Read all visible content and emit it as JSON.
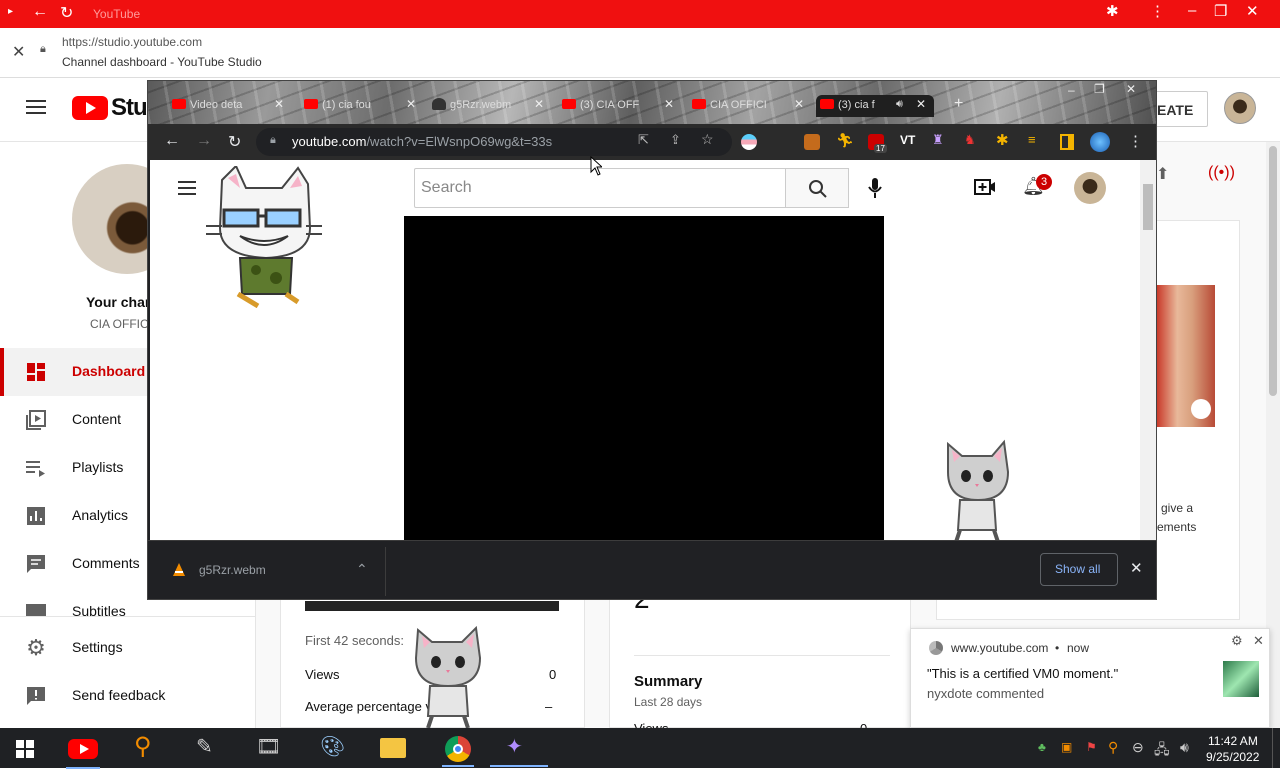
{
  "outer_window": {
    "title": "YouTube"
  },
  "popup": {
    "url": "https://studio.youtube.com",
    "title": "Channel dashboard - YouTube Studio"
  },
  "studio": {
    "logo_text": "Stud",
    "create_label": "EATE",
    "channel_label": "Your char",
    "channel_name": "CIA OFFICI",
    "nav": [
      {
        "label": "Dashboard",
        "icon": "dashboard-icon"
      },
      {
        "label": "Content",
        "icon": "content-icon"
      },
      {
        "label": "Playlists",
        "icon": "playlists-icon"
      },
      {
        "label": "Analytics",
        "icon": "analytics-icon"
      },
      {
        "label": "Comments",
        "icon": "comments-icon"
      },
      {
        "label": "Subtitles",
        "icon": "subtitles-icon"
      }
    ],
    "nav_bottom": [
      {
        "label": "Settings",
        "icon": "gear-icon"
      },
      {
        "label": "Send feedback",
        "icon": "feedback-icon"
      }
    ],
    "card_left": {
      "first_seconds": "First 42 seconds:",
      "views_label": "Views",
      "views_value": "0",
      "avg_label": "Average percentage v",
      "avg_value": "–"
    },
    "card_mid": {
      "big_number": "2",
      "summary": "Summary",
      "period": "Last 28 days",
      "views_label": "Views",
      "views_value": "0"
    },
    "card_right": {
      "text1": "give a",
      "text2": "ements"
    }
  },
  "browser": {
    "tabs": [
      {
        "label": "Video deta"
      },
      {
        "label": "(1) cia fou"
      },
      {
        "label": "g5Rzr.webm"
      },
      {
        "label": "(3) CIA OFF"
      },
      {
        "label": "CIA OFFICI"
      },
      {
        "label": "(3) cia f"
      }
    ],
    "url_host": "youtube.com",
    "url_path": "/watch?v=ElWsnpO69wg&t=33s",
    "search_placeholder": "Search",
    "notification_count": "3",
    "extension_badge": "17",
    "download_file": "g5Rzr.webm",
    "show_all": "Show all"
  },
  "notification": {
    "source": "www.youtube.com",
    "time": "now",
    "message": "\"This is a certified VM0 moment.\"",
    "author": "nyxdote commented"
  },
  "taskbar": {
    "time": "11:42 AM",
    "date": "9/25/2022"
  },
  "colors": {
    "accent": "#cc0000",
    "outer_title": "#f01010",
    "browser_bg": "#202124",
    "link_blue": "#8ab4f8"
  }
}
